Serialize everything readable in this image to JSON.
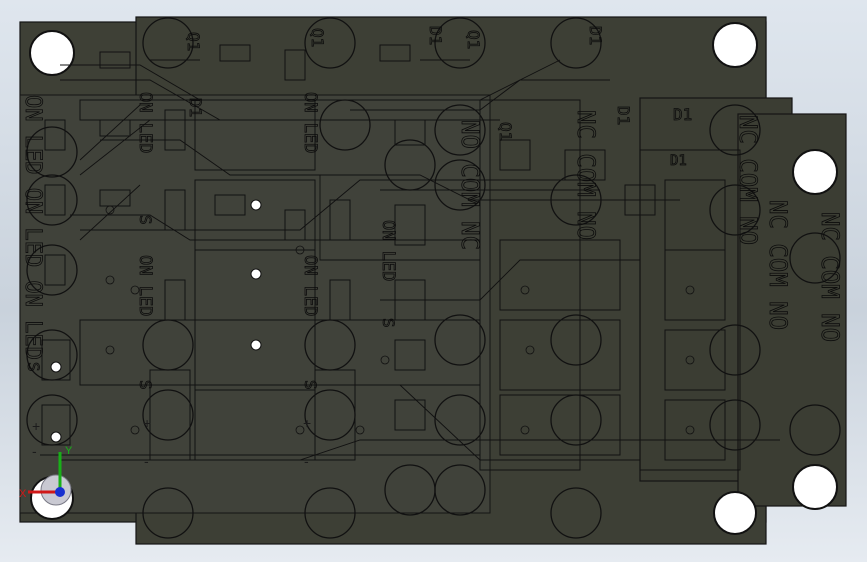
{
  "viewport": {
    "background_top": "#dfe6ee",
    "background_bottom": "#e6ebf1",
    "board_color": "#3e4036",
    "board_edge": "#141414"
  },
  "labels": {
    "left_vertical": "ON LED ON LED ON LED",
    "component_labels": [
      "Q1",
      "Q1",
      "D1",
      "Q1",
      "D1",
      "D1",
      "D1",
      "Q1",
      "D1",
      "D1"
    ],
    "led_labels": [
      "ON LED",
      "ON LED",
      "ON LED",
      "ON LED",
      "ON LED"
    ],
    "terminal_col1": "NO COM NC",
    "terminal_col2": "NC COM NO",
    "terminal_col3": "NC COM NO",
    "terminal_col4": "NC COM NO",
    "terminal_col5": "NO COM NC",
    "ncom_right": "NC COM NO",
    "s_marks": [
      "S",
      "S",
      "S",
      "S",
      "S"
    ],
    "plus_marks": [
      "+",
      "+",
      "+"
    ],
    "minus_marks": [
      "-",
      "-",
      "-"
    ]
  },
  "triad": {
    "x_label": "X",
    "y_label": "Y",
    "x_color": "#d01818",
    "y_color": "#18b018",
    "z_color": "#1830d0"
  }
}
